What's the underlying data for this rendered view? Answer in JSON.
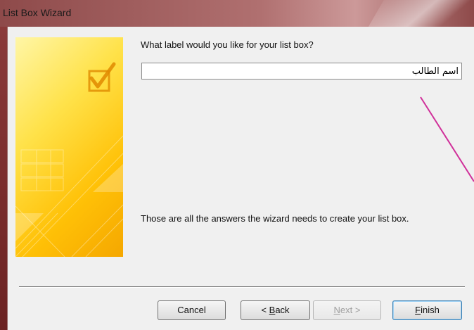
{
  "window": {
    "title": "List Box Wizard"
  },
  "wizard": {
    "question": "What label would you like for your list box?",
    "label_value": "اسم الطالب",
    "info_text": "Those are all the answers the wizard needs to create your list box."
  },
  "buttons": {
    "cancel": "Cancel",
    "back": {
      "prefix": "< ",
      "hotkey": "B",
      "rest": "ack"
    },
    "next": {
      "hotkey": "N",
      "rest": "ext >"
    },
    "finish": {
      "hotkey": "F",
      "rest": "inish"
    }
  },
  "colors": {
    "titlebar": "#8e4a4a",
    "panel_yellow": "#ffc107",
    "annotation_line": "#d0309a"
  },
  "icons": {
    "panel_check": "checkbox-check-icon"
  }
}
